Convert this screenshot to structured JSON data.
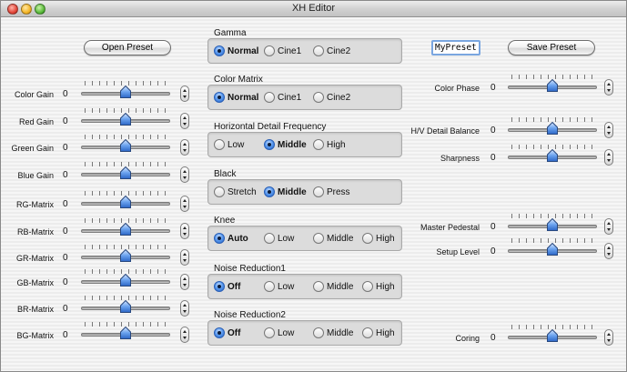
{
  "window": {
    "title": "XH Editor"
  },
  "toolbar": {
    "open_preset": "Open Preset",
    "save_preset": "Save Preset",
    "preset_name": "MyPreset"
  },
  "left_sliders": [
    {
      "label": "Color Gain",
      "value": "0",
      "position": 0.5
    },
    {
      "label": "Red Gain",
      "value": "0",
      "position": 0.5
    },
    {
      "label": "Green Gain",
      "value": "0",
      "position": 0.5
    },
    {
      "label": "Blue Gain",
      "value": "0",
      "position": 0.5
    },
    {
      "label": "RG-Matrix",
      "value": "0",
      "position": 0.5
    },
    {
      "label": "RB-Matrix",
      "value": "0",
      "position": 0.5
    },
    {
      "label": "GR-Matrix",
      "value": "0",
      "position": 0.5
    },
    {
      "label": "GB-Matrix",
      "value": "0",
      "position": 0.5
    },
    {
      "label": "BR-Matrix",
      "value": "0",
      "position": 0.5
    },
    {
      "label": "BG-Matrix",
      "value": "0",
      "position": 0.5
    }
  ],
  "right_sliders": [
    {
      "label": "Color Phase",
      "value": "0",
      "position": 0.5
    },
    {
      "label": "H/V Detail Balance",
      "value": "0",
      "position": 0.5
    },
    {
      "label": "Sharpness",
      "value": "0",
      "position": 0.5
    },
    {
      "label": "Master Pedestal",
      "value": "0",
      "position": 0.5
    },
    {
      "label": "Setup Level",
      "value": "0",
      "position": 0.5
    },
    {
      "label": "Coring",
      "value": "0",
      "position": 0.5
    }
  ],
  "groups": [
    {
      "title": "Gamma",
      "options": [
        "Normal",
        "Cine1",
        "Cine2"
      ],
      "selected": 0
    },
    {
      "title": "Color Matrix",
      "options": [
        "Normal",
        "Cine1",
        "Cine2"
      ],
      "selected": 0
    },
    {
      "title": "Horizontal Detail Frequency",
      "options": [
        "Low",
        "Middle",
        "High"
      ],
      "selected": 1
    },
    {
      "title": "Black",
      "options": [
        "Stretch",
        "Middle",
        "Press"
      ],
      "selected": 1
    },
    {
      "title": "Knee",
      "options": [
        "Auto",
        "Low",
        "Middle",
        "High"
      ],
      "selected": 0
    },
    {
      "title": "Noise Reduction1",
      "options": [
        "Off",
        "Low",
        "Middle",
        "High"
      ],
      "selected": 0
    },
    {
      "title": "Noise Reduction2",
      "options": [
        "Off",
        "Low",
        "Middle",
        "High"
      ],
      "selected": 0
    }
  ]
}
